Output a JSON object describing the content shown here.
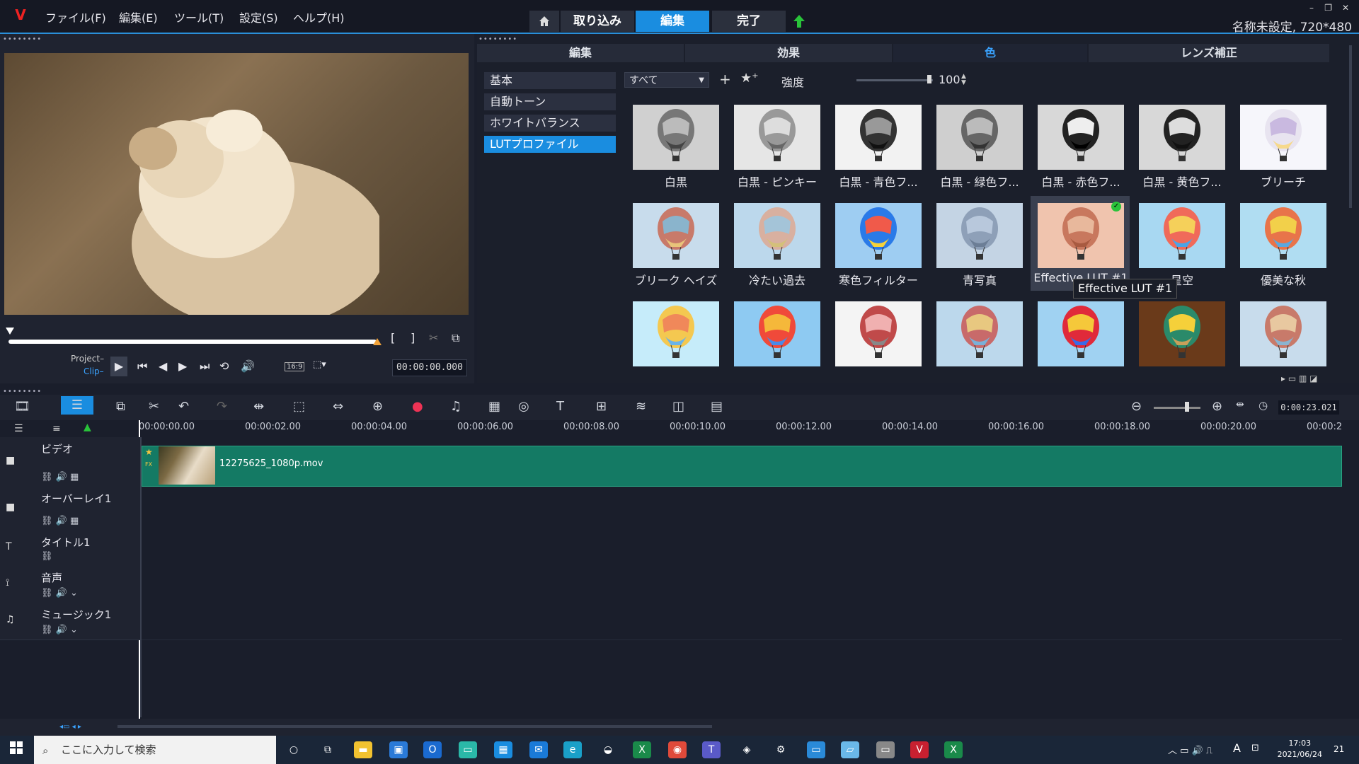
{
  "app": {
    "logo_glyph": "V",
    "project_info": "名称未設定, 720*480"
  },
  "menu": [
    "ファイル(F)",
    "編集(E)",
    "ツール(T)",
    "設定(S)",
    "ヘルプ(H)"
  ],
  "nav": {
    "home_icon": "home-icon",
    "capture": "取り込み",
    "edit": "編集",
    "share": "完了"
  },
  "window_controls": [
    "–",
    "❐",
    "✕"
  ],
  "player": {
    "timecode": "00:00:00.000",
    "project_label": "Project",
    "clip_label": "Clip",
    "aspect": "16:9",
    "scrub_position": 0
  },
  "library": {
    "tabs": [
      "編集",
      "効果",
      "色",
      "レンズ補正"
    ],
    "active_tab": "色",
    "categories": [
      "基本",
      "自動トーン",
      "ホワイトバランス",
      "LUTプロファイル"
    ],
    "active_category": "LUTプロファイル",
    "filter": "すべて",
    "strength_label": "強度",
    "strength_value": "100",
    "thumbnails": [
      {
        "label": "白黒"
      },
      {
        "label": "白黒 - ピンキー"
      },
      {
        "label": "白黒 - 青色フ..."
      },
      {
        "label": "白黒 - 緑色フ..."
      },
      {
        "label": "白黒 - 赤色フ..."
      },
      {
        "label": "白黒 - 黄色フ..."
      },
      {
        "label": "ブリーチ"
      },
      {
        "label": "ブリーク ヘイズ"
      },
      {
        "label": "冷たい過去"
      },
      {
        "label": "寒色フィルター"
      },
      {
        "label": "青写真"
      },
      {
        "label": "Effective LUT #1"
      },
      {
        "label": "星空"
      },
      {
        "label": "優美な秋"
      },
      {
        "label": ""
      },
      {
        "label": ""
      },
      {
        "label": ""
      },
      {
        "label": ""
      },
      {
        "label": ""
      },
      {
        "label": ""
      },
      {
        "label": ""
      }
    ],
    "tooltip": "Effective LUT #1"
  },
  "timeline": {
    "zoom_timecode": "0:00:23.021",
    "ticks": [
      "00:00:00.00",
      "00:00:02.00",
      "00:00:04.00",
      "00:00:06.00",
      "00:00:08.00",
      "00:00:10.00",
      "00:00:12.00",
      "00:00:14.00",
      "00:00:16.00",
      "00:00:18.00",
      "00:00:20.00",
      "00:00:2"
    ],
    "tracks": [
      {
        "name": "ビデオ",
        "icon": "video-track-icon"
      },
      {
        "name": "オーバーレイ1",
        "icon": "overlay-track-icon"
      },
      {
        "name": "タイトル1",
        "icon": "title-track-icon"
      },
      {
        "name": "音声",
        "icon": "voice-track-icon"
      },
      {
        "name": "ミュージック1",
        "icon": "music-track-icon"
      }
    ],
    "clip": {
      "name": "12275625_1080p.mov"
    }
  },
  "taskbar": {
    "search_placeholder": "ここに入力して検索",
    "time": "17:03",
    "date": "2021/06/24",
    "notif_count": "21",
    "ime": "A"
  },
  "colors": {
    "accent": "#1a8de0",
    "clip": "#147a64",
    "panel": "#1f2330"
  }
}
